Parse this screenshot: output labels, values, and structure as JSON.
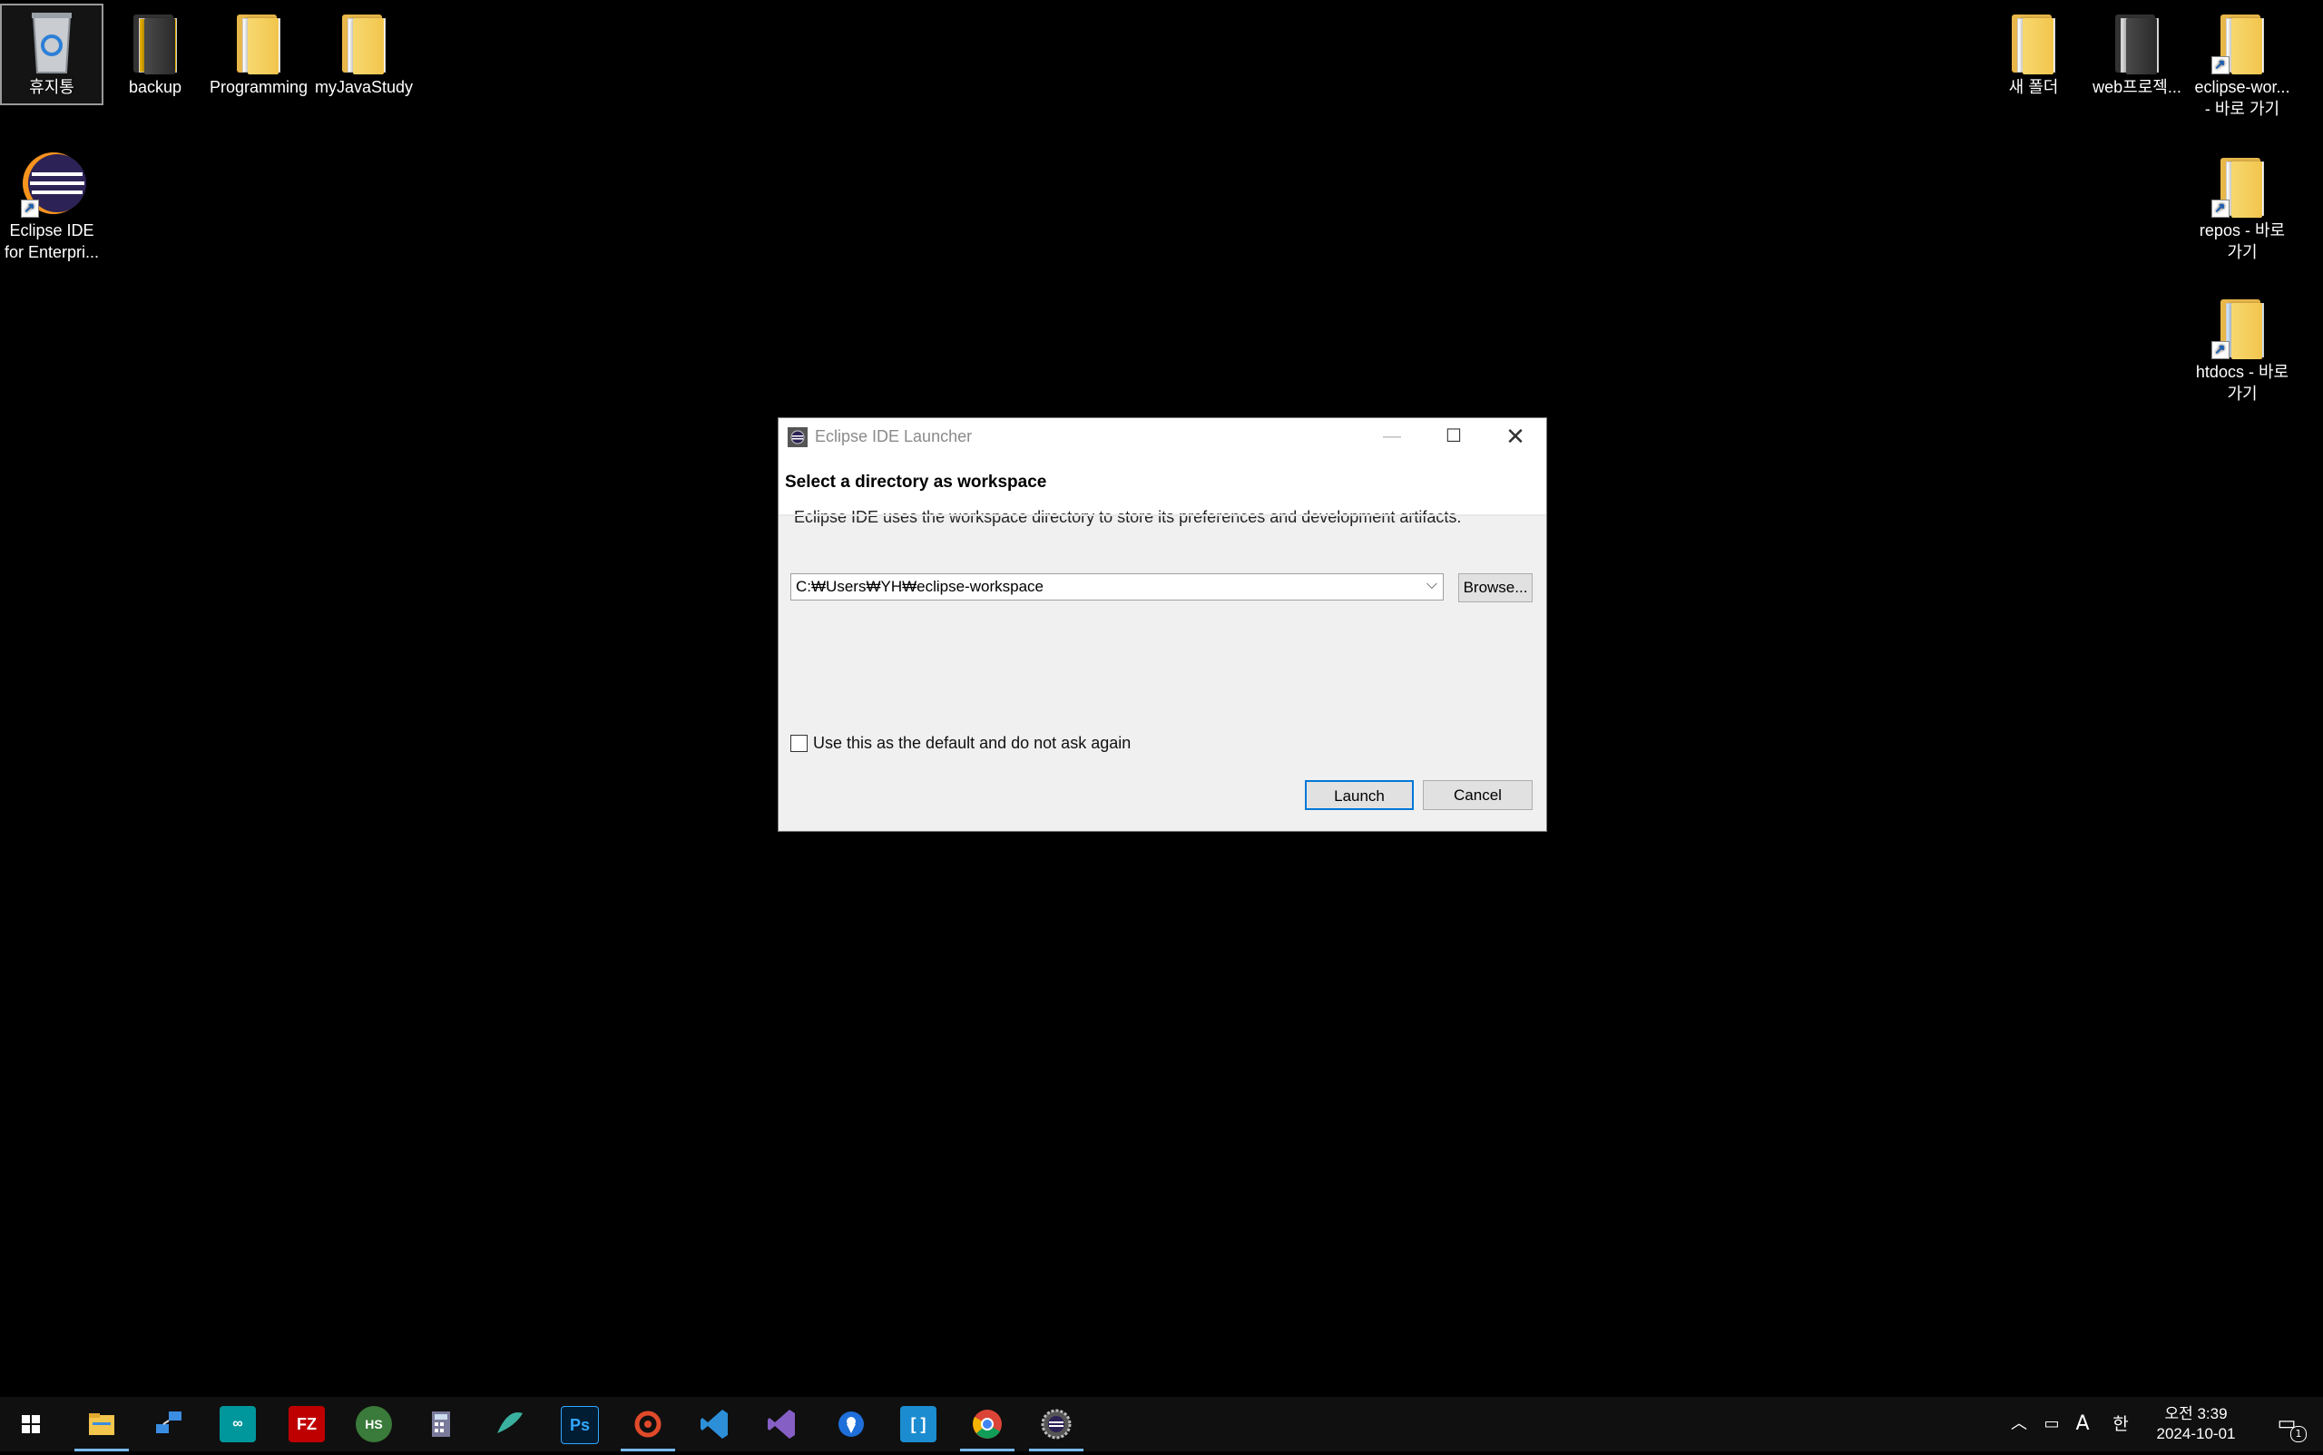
{
  "desktop": {
    "recycle_bin": "휴지통",
    "backup": "backup",
    "programming": "Programming",
    "myjavastudy": "myJavaStudy",
    "eclipse_line1": "Eclipse IDE",
    "eclipse_line2": "for Enterpri...",
    "new_folder": "새 폴더",
    "web_project": "web프로젝...",
    "eclipse_ws_line1": "eclipse-wor...",
    "eclipse_ws_line2": "- 바로 가기",
    "repos_line1": "repos - 바로",
    "repos_line2": "가기",
    "htdocs_line1": "htdocs - 바로",
    "htdocs_line2": "가기"
  },
  "dialog": {
    "window_title": "Eclipse IDE Launcher",
    "heading": "Select a directory as workspace",
    "description": "Eclipse IDE uses the workspace directory to store its preferences and development artifacts.",
    "workspace_path": "C:₩Users₩YH₩eclipse-workspace",
    "browse_label": "Browse...",
    "default_checkbox_label": "Use this as the default and do not ask again",
    "default_checked": false,
    "launch_label": "Launch",
    "cancel_label": "Cancel"
  },
  "taskbar": {
    "apps": [
      "start-icon",
      "file-explorer-icon",
      "network-icon",
      "arduino-icon",
      "filezilla-icon",
      "hs-icon",
      "calculator-icon",
      "fish-icon",
      "photoshop-icon",
      "swirl-icon",
      "vscode-icon",
      "visual-studio-icon",
      "maps-icon",
      "bracket-icon",
      "chrome-icon",
      "eclipse-icon"
    ],
    "filezilla_label": "FZ",
    "photoshop_label": "Ps",
    "hs_label": "HS",
    "ime_label": "A",
    "lang_label": "한",
    "time": "오전 3:39",
    "date": "2024-10-01",
    "notification_count": "1"
  },
  "colors": {
    "desktop_bg": "#000000",
    "accent": "#0078d7",
    "taskbar_bg": "#101010"
  }
}
